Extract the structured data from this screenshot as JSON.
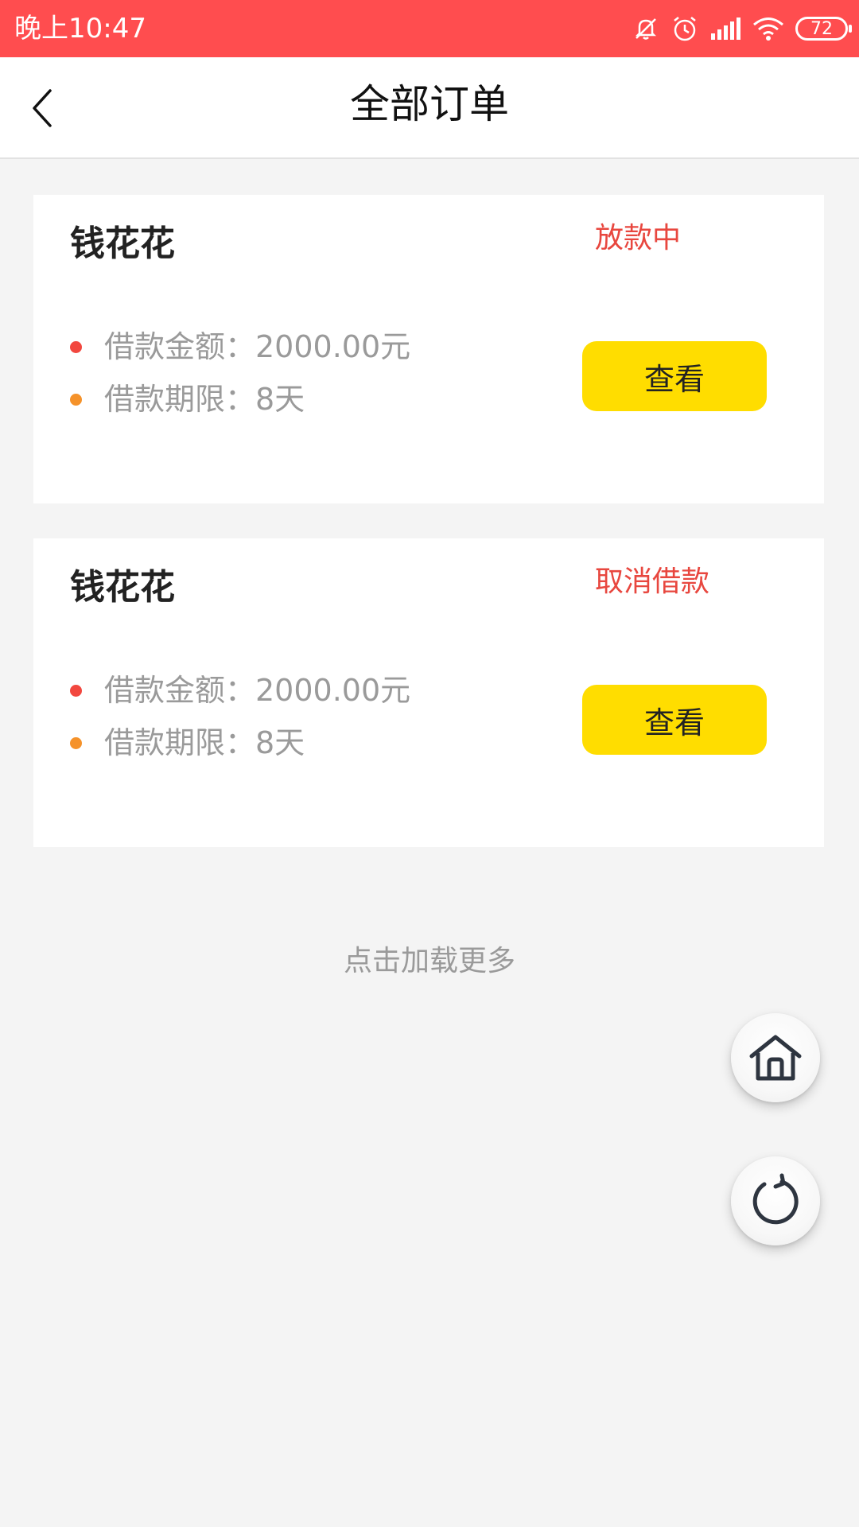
{
  "status_bar": {
    "time": "晚上10:47",
    "battery": "72",
    "icons": [
      "mute-icon",
      "alarm-icon",
      "signal-icon",
      "wifi-icon",
      "battery-icon"
    ]
  },
  "nav": {
    "title": "全部订单",
    "back_icon": "chevron-left-icon"
  },
  "orders": [
    {
      "product": "钱花花",
      "status": "放款中",
      "amount_text": "借款金额：2000.00元",
      "term_text": "借款期限：8天",
      "button_label": "查看"
    },
    {
      "product": "钱花花",
      "status": "取消借款",
      "amount_text": "借款金额：2000.00元",
      "term_text": "借款期限：8天",
      "button_label": "查看"
    }
  ],
  "load_more": "点击加载更多",
  "floating_buttons": {
    "home_icon": "home-icon",
    "refresh_icon": "refresh-icon"
  },
  "colors": {
    "status_bar": "#ff4d4f",
    "status_text": "#e8473f",
    "button_bg": "#ffdd00",
    "dot_amount": "#f2473f",
    "dot_term": "#f5922a",
    "page_bg": "#f4f4f4"
  }
}
